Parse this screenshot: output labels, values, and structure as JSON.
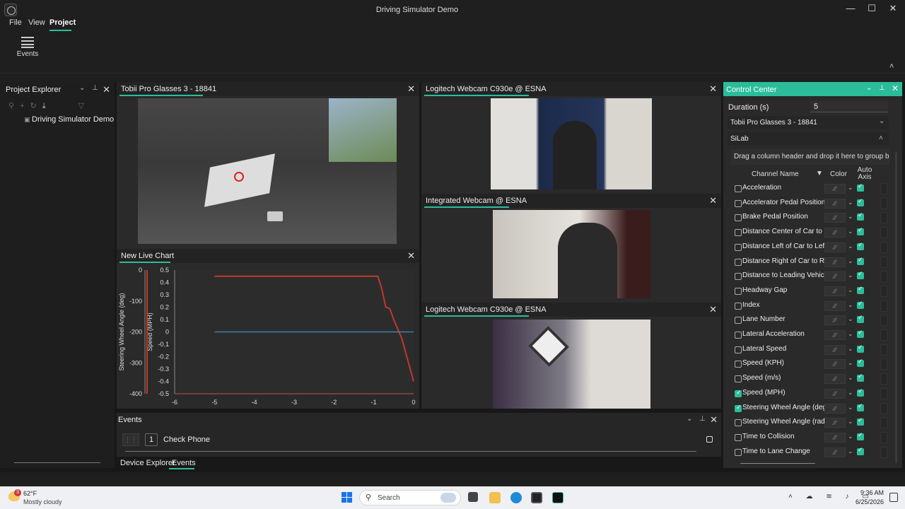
{
  "window": {
    "title": "Driving Simulator Demo",
    "minimize": "—",
    "maximize": "☐",
    "close": "✕"
  },
  "menu": {
    "file": "File",
    "view": "View",
    "project": "Project"
  },
  "ribbon": {
    "events_label": "Events",
    "collapse": "˄"
  },
  "project_explorer": {
    "title": "Project Explorer",
    "item": "Driving Simulator Demo",
    "chev": "⌄",
    "pin": "⊥",
    "close": "✕"
  },
  "panels": {
    "tobii": "Tobii Pro Glasses 3 - 18841",
    "logitech1": "Logitech Webcam C930e @ ESNA",
    "integrated": "Integrated Webcam @ ESNA",
    "logitech2": "Logitech Webcam C930e @ ESNA",
    "chart": "New Live Chart",
    "close": "✕"
  },
  "chart_data": {
    "type": "line",
    "x_ticks": [
      "-6",
      "-5",
      "-4",
      "-3",
      "-2",
      "-1",
      "0"
    ],
    "xlim": [
      -6,
      0
    ],
    "y_left": {
      "label": "Steering Wheel Angle (deg)",
      "ticks": [
        "0",
        "-100",
        "-200",
        "-300",
        "-400"
      ],
      "range": [
        -400,
        0
      ]
    },
    "y_right": {
      "label": "Speed (MPH)",
      "ticks": [
        "0.5",
        "0.4",
        "0.3",
        "0.2",
        "0.1",
        "0",
        "-0.1",
        "-0.2",
        "-0.3",
        "-0.4",
        "-0.5"
      ],
      "range": [
        -0.5,
        0.5
      ]
    },
    "series": [
      {
        "color": "#c0392b",
        "axis": "right",
        "x": [
          -5,
          -0.9,
          -0.8,
          -0.7,
          -0.6,
          -0.5,
          -0.3,
          0
        ],
        "y": [
          0.45,
          0.45,
          0.35,
          0.2,
          0.19,
          0.1,
          -0.05,
          -0.4
        ]
      },
      {
        "color": "#3a8dc8",
        "axis": "left",
        "x": [
          -5,
          0
        ],
        "y": [
          -200,
          -200
        ]
      }
    ]
  },
  "events_panel": {
    "title": "Events",
    "index": "1",
    "event_name": "Check Phone"
  },
  "bottom_tabs": {
    "device_explorer": "Device Explorer",
    "events": "Events"
  },
  "control_center": {
    "title": "Control Center",
    "duration_label": "Duration (s)",
    "duration_value": "5",
    "device": "Tobii Pro Glasses 3 - 18841",
    "group": "SiLab",
    "group_hint": "Drag a column header and drop it here to group by t",
    "col_channel": "Channel Name",
    "col_color": "Color",
    "col_auto": "Auto Axis",
    "channels": [
      {
        "name": "Acceleration",
        "checked": false
      },
      {
        "name": "Accelerator Pedal Position",
        "checked": false
      },
      {
        "name": "Brake Pedal Position",
        "checked": false
      },
      {
        "name": "Distance Center of Car to Ce",
        "checked": false
      },
      {
        "name": "Distance Left of Car to Left",
        "checked": false
      },
      {
        "name": "Distance Right of Car to Rig",
        "checked": false
      },
      {
        "name": "Distance to Leading Vehicle",
        "checked": false
      },
      {
        "name": "Headway Gap",
        "checked": false
      },
      {
        "name": "Index",
        "checked": false
      },
      {
        "name": "Lane Number",
        "checked": false
      },
      {
        "name": "Lateral Acceleration",
        "checked": false
      },
      {
        "name": "Lateral Speed",
        "checked": false
      },
      {
        "name": "Speed (KPH)",
        "checked": false
      },
      {
        "name": "Speed (m/s)",
        "checked": false
      },
      {
        "name": "Speed (MPH)",
        "checked": true
      },
      {
        "name": "Steering Wheel Angle (deg)",
        "checked": true
      },
      {
        "name": "Steering Wheel Angle (rad)",
        "checked": false
      },
      {
        "name": "Time to Collision",
        "checked": false
      },
      {
        "name": "Time to Lane Change",
        "checked": false
      }
    ]
  },
  "taskbar": {
    "weather_temp": "62°F",
    "weather_desc": "Mostly cloudy",
    "weather_badge": "3",
    "search_placeholder": "Search",
    "time": "9:36 AM",
    "date": "6/25/2026"
  }
}
